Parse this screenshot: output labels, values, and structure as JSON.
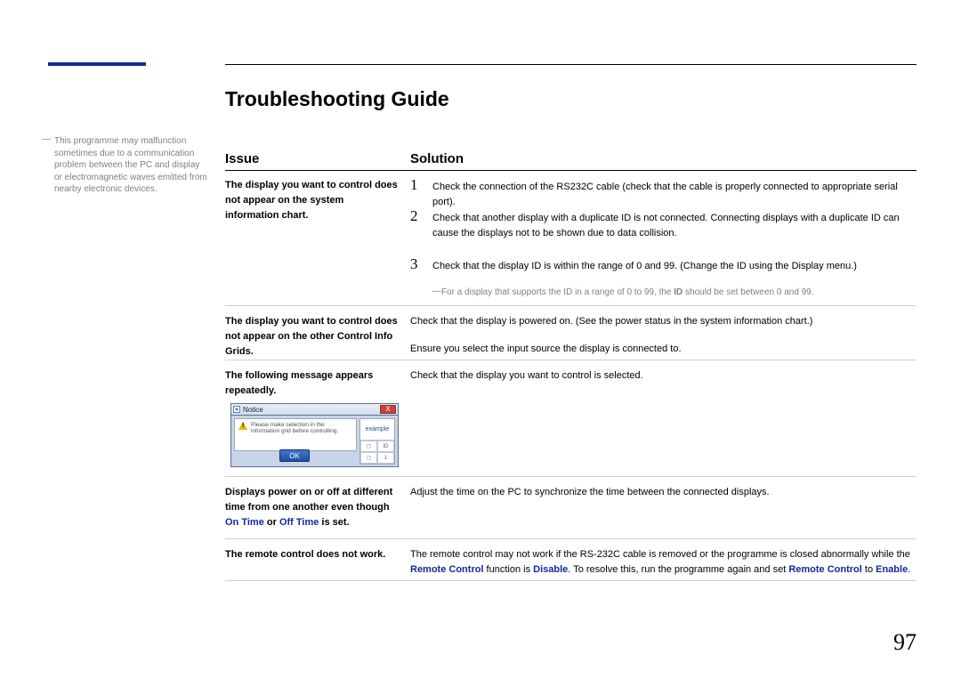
{
  "accent_color": "#1428a0",
  "title": "Troubleshooting Guide",
  "side_note": "This programme may malfunction sometimes due to a communication problem between the PC and display or electromagnetic waves emitted from nearby electronic devices.",
  "headers": {
    "issue": "Issue",
    "solution": "Solution"
  },
  "rows": {
    "r1": {
      "issue": "The display you want to control does not appear on the system information chart.",
      "s1": "Check the connection of the RS232C cable (check that the cable is properly connected to appropriate serial port).",
      "s2": "Check that another display with a duplicate ID is not connected. Connecting displays with a duplicate ID can cause the displays not to be shown due to data collision.",
      "s3": "Check that the display ID is within the range of 0 and 99. (Change the ID using the Display menu.)",
      "note_pre": "For a display that supports the ID in a range of 0 to 99, the ",
      "note_b": "ID",
      "note_post": " should be set between 0 and 99."
    },
    "r2": {
      "issue": "The display you want to control does not appear on the other Control Info Grids.",
      "s1": "Check that the display is powered on. (See the power status in the system information chart.)",
      "s2": "Ensure you select the input source the display is connected to."
    },
    "r3": {
      "issue": "The following message appears repeatedly.",
      "s1": "Check that the display you want to control is selected."
    },
    "r4": {
      "issue_a": "Displays power on or off at different time from one another even though ",
      "issue_b1": "On Time",
      "issue_mid": " or ",
      "issue_b2": "Off Time",
      "issue_c": " is set.",
      "s1": "Adjust the time on the PC to synchronize the time between the connected displays."
    },
    "r5": {
      "issue": "The remote control does not work.",
      "s1_a": "The remote control may not work if the RS-232C cable is removed or the programme is closed abnormally while the ",
      "s1_b1": "Remote Control",
      "s1_mid1": " function is ",
      "s1_b2": "Disable",
      "s1_mid2": ". To resolve this, run the programme again and set ",
      "s1_b3": "Remote Control",
      "s1_mid3": " to ",
      "s1_b4": "Enable",
      "s1_end": "."
    }
  },
  "dialog": {
    "title": "Notice",
    "message": "Please make selection in the information grid before controlling.",
    "ok": "OK",
    "example": "example",
    "close": "X"
  },
  "nums": {
    "n1": "1",
    "n2": "2",
    "n3": "3"
  },
  "page_number": "97"
}
